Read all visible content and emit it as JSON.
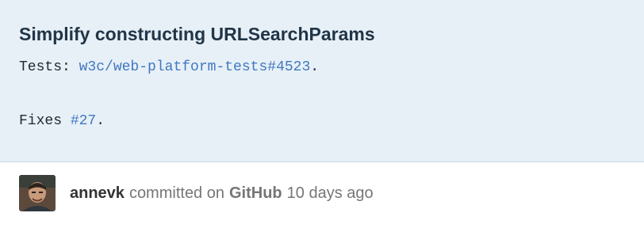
{
  "commit": {
    "title": "Simplify constructing URLSearchParams",
    "tests_label": "Tests: ",
    "tests_link": "w3c/web-platform-tests#4523",
    "tests_suffix": ".",
    "fixes_label": "Fixes ",
    "fixes_link": "#27",
    "fixes_suffix": "."
  },
  "meta": {
    "author": "annevk",
    "committed_on": "committed on",
    "platform": "GitHub",
    "time_ago": "10 days ago",
    "avatar_icon": "user-avatar"
  },
  "colors": {
    "box_bg": "#e7f0f7",
    "link": "#4078c0",
    "muted": "#767676"
  }
}
